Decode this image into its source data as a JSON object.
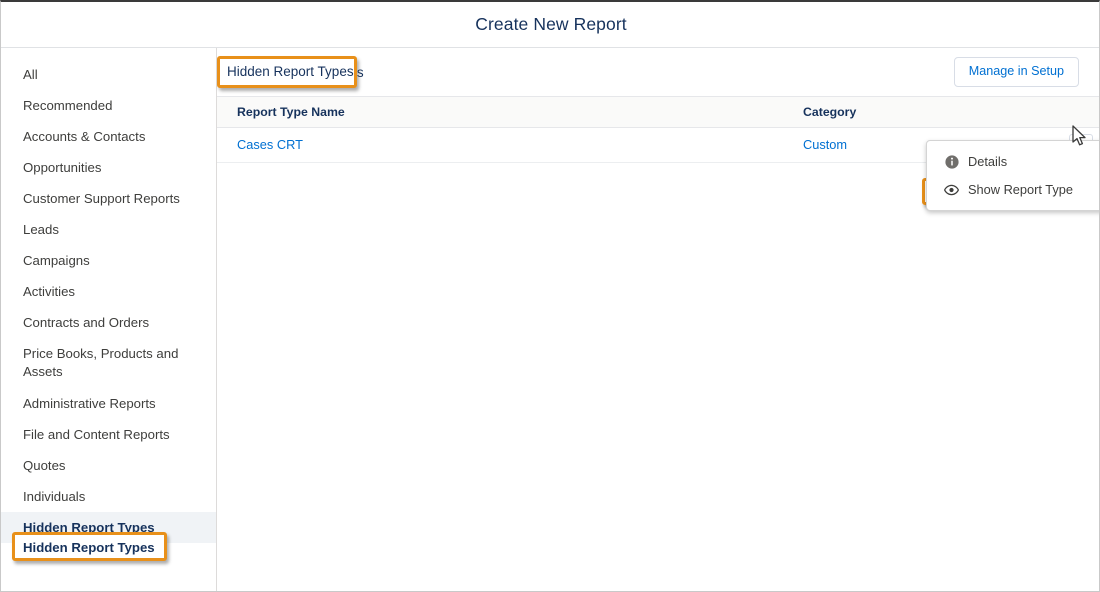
{
  "window": {
    "title": "Create New Report"
  },
  "sidebar": {
    "items": [
      {
        "label": "All",
        "selected": false
      },
      {
        "label": "Recommended",
        "selected": false
      },
      {
        "label": "Accounts & Contacts",
        "selected": false
      },
      {
        "label": "Opportunities",
        "selected": false
      },
      {
        "label": "Customer Support Reports",
        "selected": false
      },
      {
        "label": "Leads",
        "selected": false
      },
      {
        "label": "Campaigns",
        "selected": false
      },
      {
        "label": "Activities",
        "selected": false
      },
      {
        "label": "Contracts and Orders",
        "selected": false
      },
      {
        "label": "Price Books, Products and Assets",
        "selected": false
      },
      {
        "label": "Administrative Reports",
        "selected": false
      },
      {
        "label": "File and Content Reports",
        "selected": false
      },
      {
        "label": "Quotes",
        "selected": false
      },
      {
        "label": "Individuals",
        "selected": false
      },
      {
        "label": "Hidden Report Types",
        "selected": true
      }
    ]
  },
  "main": {
    "section_title": "Hidden Report Types",
    "manage_button_label": "Manage in Setup",
    "table": {
      "columns": [
        "Report Type Name",
        "Category",
        ""
      ],
      "rows": [
        {
          "name": "Cases CRT",
          "category": "Custom"
        }
      ]
    }
  },
  "row_menu": {
    "items": [
      {
        "label": "Details",
        "icon": "info-icon",
        "highlighted": false
      },
      {
        "label": "Show Report Type",
        "icon": "eye-icon",
        "highlighted": true
      }
    ]
  },
  "icons": {
    "row_action": "chevron-down-icon",
    "pointer": "cursor-pointer-icon"
  },
  "colors": {
    "callout": "#e8901a",
    "link": "#0070d2",
    "selected_row_bg": "#f0f3f6",
    "header_text": "#16325c"
  }
}
